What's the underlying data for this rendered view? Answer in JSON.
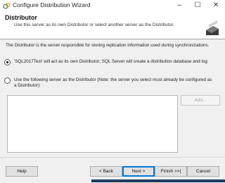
{
  "window": {
    "title": "Configure Distribution Wizard",
    "minimize": "–",
    "maximize": "☐",
    "close": "✕"
  },
  "header": {
    "title": "Distributor",
    "subtitle": "Use this server as its own Distributor or select another server as the Distributor."
  },
  "content": {
    "description": "The Distributor is the server responsible for storing replication information used during synchronizations.",
    "option_own": "'SQL2017Test' will act as its own Distributor; SQL Server will create a distribution database and log",
    "option_own_selected": true,
    "option_other": "Use the following server as the Distributor (Note: the server you select must already be configured as a Distributor):",
    "option_other_selected": false,
    "add_button": "Add..."
  },
  "footer": {
    "help": "Help",
    "back": "< Back",
    "next": "Next >",
    "finish": "Finish >>|",
    "cancel": "Cancel"
  },
  "colors": {
    "accent": "#0078d7",
    "header_bg": "#ffffff",
    "content_bg": "#f0f0f0"
  }
}
